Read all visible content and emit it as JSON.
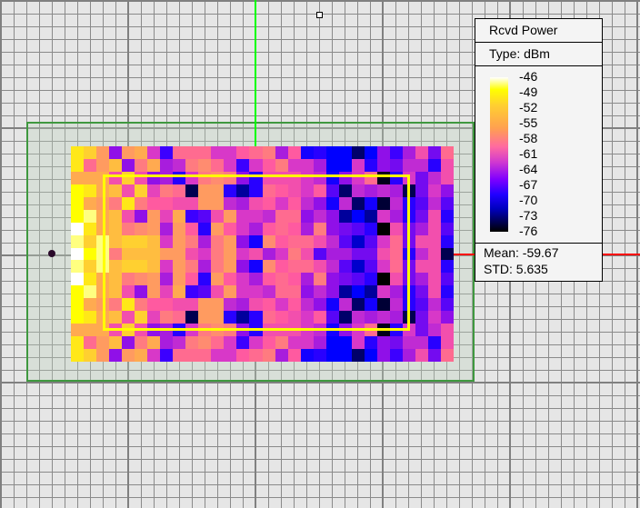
{
  "legend": {
    "title": "Rcvd Power",
    "type": "Type: dBm",
    "ticks": [
      "-46",
      "-49",
      "-52",
      "-55",
      "-58",
      "-61",
      "-64",
      "-67",
      "-70",
      "-73",
      "-76"
    ],
    "mean": "Mean: -59.67",
    "std": "STD: 5.635"
  },
  "colors": {
    "region": "#3f983f",
    "axis_y": "#00ff00",
    "axis_x": "#ff0000",
    "study_rect": "#ffff00"
  },
  "chart_data": {
    "type": "heatmap",
    "title": "Rcvd Power",
    "unit": "dBm",
    "range": [
      -76,
      -46
    ],
    "rows": 17,
    "cols": 30,
    "values": [
      [
        -49,
        -50,
        -53,
        -63,
        -53,
        -52,
        -60,
        -66,
        -56,
        -56,
        -56,
        -60,
        -60,
        -57,
        -56,
        -55,
        -62,
        -57,
        -68,
        -67,
        -69,
        -69,
        -72,
        -69,
        -63,
        -66,
        -62,
        -58,
        -64,
        -56
      ],
      [
        -49,
        -56,
        -53,
        -51,
        -63,
        -55,
        -52,
        -62,
        -61,
        -55,
        -54,
        -56,
        -60,
        -66,
        -60,
        -57,
        -55,
        -60,
        -60,
        -62,
        -69,
        -69,
        -60,
        -67,
        -63,
        -64,
        -61,
        -61,
        -67,
        -58
      ],
      [
        -52,
        -52,
        -52,
        -58,
        -50,
        -58,
        -63,
        -62,
        -67,
        -60,
        -55,
        -54,
        -55,
        -63,
        -67,
        -58,
        -58,
        -58,
        -60,
        -61,
        -68,
        -63,
        -60,
        -56,
        -75,
        -67,
        -60,
        -64,
        -61,
        -58
      ],
      [
        -48,
        -49,
        -52,
        -51,
        -58,
        -50,
        -59,
        -55,
        -56,
        -73,
        -53,
        -53,
        -67,
        -71,
        -67,
        -56,
        -57,
        -58,
        -60,
        -57,
        -65,
        -72,
        -61,
        -62,
        -61,
        -62,
        -73,
        -64,
        -60,
        -63
      ],
      [
        -48,
        -52,
        -53,
        -55,
        -49,
        -55,
        -57,
        -57,
        -58,
        -58,
        -53,
        -53,
        -61,
        -62,
        -58,
        -57,
        -60,
        -57,
        -61,
        -63,
        -68,
        -61,
        -72,
        -68,
        -74,
        -61,
        -67,
        -65,
        -61,
        -65
      ],
      [
        -48,
        -47,
        -52,
        -51,
        -58,
        -63,
        -53,
        -59,
        -52,
        -66,
        -65,
        -58,
        -53,
        -60,
        -60,
        -61,
        -56,
        -56,
        -63,
        -61,
        -63,
        -71,
        -69,
        -71,
        -60,
        -62,
        -67,
        -64,
        -58,
        -67
      ],
      [
        -46,
        -49,
        -52,
        -51,
        -55,
        -54,
        -53,
        -62,
        -53,
        -57,
        -67,
        -53,
        -57,
        -60,
        -62,
        -57,
        -56,
        -57,
        -62,
        -55,
        -63,
        -64,
        -65,
        -67,
        -76,
        -58,
        -64,
        -62,
        -58,
        -65
      ],
      [
        -47,
        -50,
        -47,
        -51,
        -50,
        -50,
        -51,
        -60,
        -53,
        -55,
        -62,
        -55,
        -53,
        -63,
        -68,
        -54,
        -57,
        -56,
        -56,
        -58,
        -61,
        -65,
        -70,
        -65,
        -60,
        -56,
        -64,
        -58,
        -58,
        -67
      ],
      [
        -46,
        -48,
        -47,
        -55,
        -51,
        -51,
        -51,
        -53,
        -53,
        -58,
        -60,
        -55,
        -53,
        -60,
        -58,
        -62,
        -60,
        -55,
        -58,
        -65,
        -62,
        -62,
        -64,
        -64,
        -58,
        -56,
        -67,
        -61,
        -58,
        -73
      ],
      [
        -47,
        -50,
        -47,
        -51,
        -50,
        -50,
        -51,
        -60,
        -53,
        -55,
        -62,
        -55,
        -53,
        -63,
        -68,
        -54,
        -57,
        -56,
        -56,
        -58,
        -61,
        -65,
        -70,
        -65,
        -60,
        -56,
        -64,
        -58,
        -58,
        -67
      ],
      [
        -46,
        -49,
        -52,
        -51,
        -55,
        -54,
        -53,
        -62,
        -53,
        -57,
        -67,
        -53,
        -57,
        -60,
        -62,
        -57,
        -56,
        -57,
        -62,
        -55,
        -63,
        -64,
        -65,
        -67,
        -76,
        -58,
        -64,
        -62,
        -58,
        -65
      ],
      [
        -48,
        -47,
        -52,
        -51,
        -58,
        -63,
        -53,
        -59,
        -52,
        -66,
        -65,
        -58,
        -53,
        -60,
        -60,
        -61,
        -56,
        -56,
        -63,
        -61,
        -63,
        -71,
        -69,
        -71,
        -60,
        -62,
        -67,
        -64,
        -58,
        -67
      ],
      [
        -48,
        -52,
        -53,
        -55,
        -49,
        -55,
        -57,
        -57,
        -58,
        -58,
        -53,
        -53,
        -61,
        -62,
        -58,
        -57,
        -60,
        -57,
        -61,
        -63,
        -68,
        -61,
        -72,
        -68,
        -74,
        -61,
        -67,
        -65,
        -61,
        -65
      ],
      [
        -48,
        -49,
        -52,
        -51,
        -58,
        -50,
        -59,
        -55,
        -56,
        -73,
        -53,
        -53,
        -67,
        -71,
        -67,
        -56,
        -57,
        -58,
        -60,
        -57,
        -65,
        -72,
        -61,
        -62,
        -61,
        -62,
        -73,
        -64,
        -60,
        -63
      ],
      [
        -52,
        -52,
        -52,
        -58,
        -50,
        -58,
        -63,
        -62,
        -67,
        -60,
        -55,
        -54,
        -55,
        -63,
        -67,
        -58,
        -58,
        -58,
        -60,
        -61,
        -68,
        -63,
        -60,
        -56,
        -75,
        -67,
        -60,
        -64,
        -61,
        -58
      ],
      [
        -49,
        -56,
        -53,
        -51,
        -63,
        -55,
        -52,
        -62,
        -61,
        -55,
        -54,
        -56,
        -60,
        -66,
        -60,
        -57,
        -55,
        -60,
        -60,
        -62,
        -69,
        -69,
        -60,
        -67,
        -63,
        -64,
        -61,
        -61,
        -67,
        -58
      ],
      [
        -49,
        -50,
        -53,
        -63,
        -53,
        -52,
        -60,
        -66,
        -56,
        -56,
        -56,
        -60,
        -60,
        -57,
        -56,
        -55,
        -62,
        -57,
        -68,
        -67,
        -69,
        -69,
        -72,
        -69,
        -63,
        -66,
        -62,
        -58,
        -64,
        -56
      ]
    ]
  }
}
